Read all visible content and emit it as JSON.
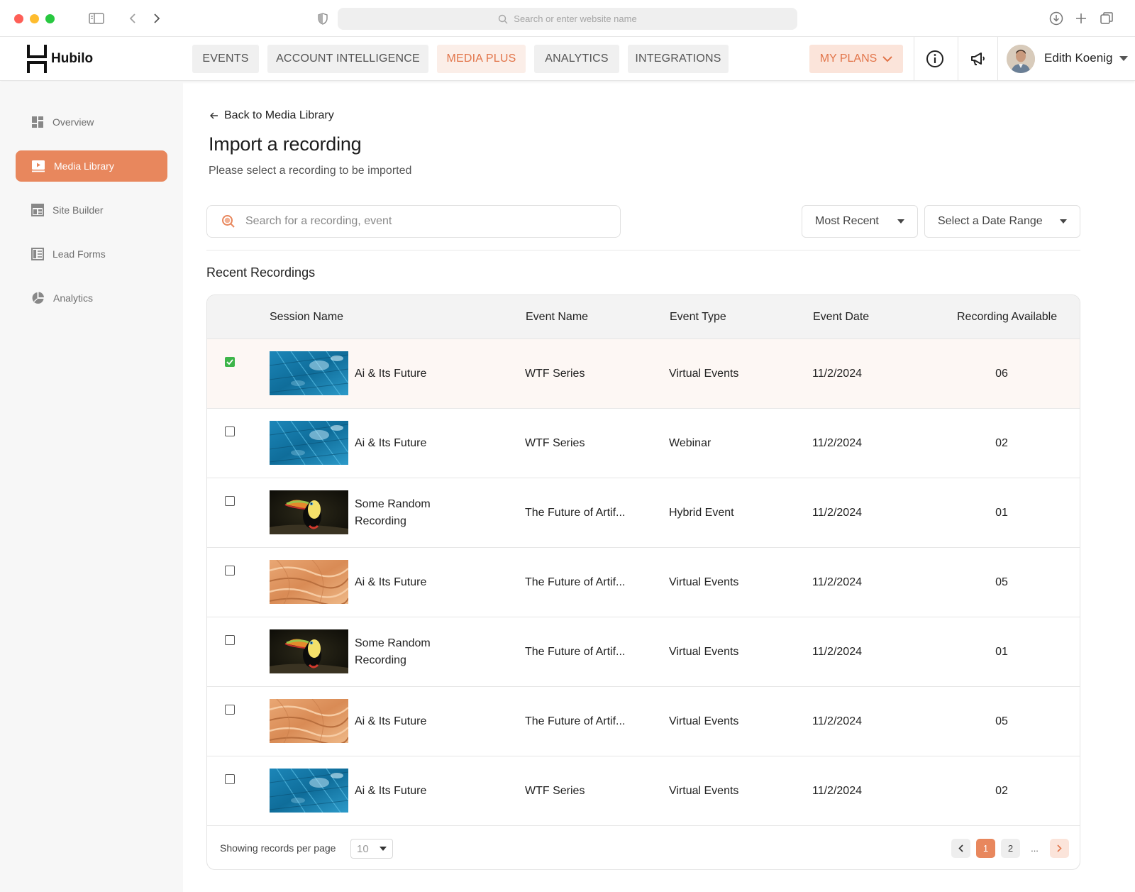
{
  "browser": {
    "url_placeholder": "Search or enter website name"
  },
  "app": {
    "logo_text": "Hubilo",
    "nav_tabs": [
      {
        "label": "EVENTS",
        "active": false
      },
      {
        "label": "ACCOUNT INTELLIGENCE",
        "active": false
      },
      {
        "label": "MEDIA PLUS",
        "active": true
      },
      {
        "label": "ANALYTICS",
        "active": false
      },
      {
        "label": "INTEGRATIONS",
        "active": false
      }
    ],
    "plans_label": "MY PLANS",
    "user_name": "Edith Koenig",
    "accent_color": "#e8875d"
  },
  "sidebar": {
    "items": [
      {
        "label": "Overview",
        "icon": "grid-icon",
        "active": false
      },
      {
        "label": "Media Library",
        "icon": "video-icon",
        "active": true
      },
      {
        "label": "Site Builder",
        "icon": "layout-icon",
        "active": false
      },
      {
        "label": "Lead Forms",
        "icon": "form-icon",
        "active": false
      },
      {
        "label": "Analytics",
        "icon": "pie-icon",
        "active": false
      }
    ]
  },
  "main": {
    "back_label": "Back to Media Library",
    "title": "Import a recording",
    "subtitle": "Please select a recording to be imported",
    "search_placeholder": "Search for a recording, event",
    "sort_label": "Most Recent",
    "date_label": "Select a Date Range",
    "section_title": "Recent Recordings"
  },
  "table": {
    "columns": [
      "Session Name",
      "Event Name",
      "Event Type",
      "Event Date",
      "Recording Available"
    ],
    "rows": [
      {
        "checked": true,
        "thumb": "water",
        "session": "Ai & Its Future",
        "event": "WTF Series",
        "type": "Virtual Events",
        "date": "11/2/2024",
        "available": "06"
      },
      {
        "checked": false,
        "thumb": "water",
        "session": "Ai & Its Future",
        "event": "WTF Series",
        "type": "Webinar",
        "date": "11/2/2024",
        "available": "02"
      },
      {
        "checked": false,
        "thumb": "toucan",
        "session": "Some Random Recording",
        "event": "The Future of Artif...",
        "type": "Hybrid Event",
        "date": "11/2/2024",
        "available": "01"
      },
      {
        "checked": false,
        "thumb": "sand",
        "session": "Ai & Its Future",
        "event": "The Future of Artif...",
        "type": "Virtual Events",
        "date": "11/2/2024",
        "available": "05"
      },
      {
        "checked": false,
        "thumb": "toucan",
        "session": "Some Random Recording",
        "event": "The Future of Artif...",
        "type": "Virtual Events",
        "date": "11/2/2024",
        "available": "01"
      },
      {
        "checked": false,
        "thumb": "sand",
        "session": "Ai & Its Future",
        "event": "The Future of Artif...",
        "type": "Virtual Events",
        "date": "11/2/2024",
        "available": "05"
      },
      {
        "checked": false,
        "thumb": "water",
        "session": "Ai & Its Future",
        "event": "WTF Series",
        "type": "Virtual Events",
        "date": "11/2/2024",
        "available": "02"
      }
    ],
    "footer": {
      "per_page_label": "Showing records per page",
      "per_page_value": "10",
      "current_page": "1",
      "next_page": "2",
      "ellipsis": "..."
    }
  }
}
